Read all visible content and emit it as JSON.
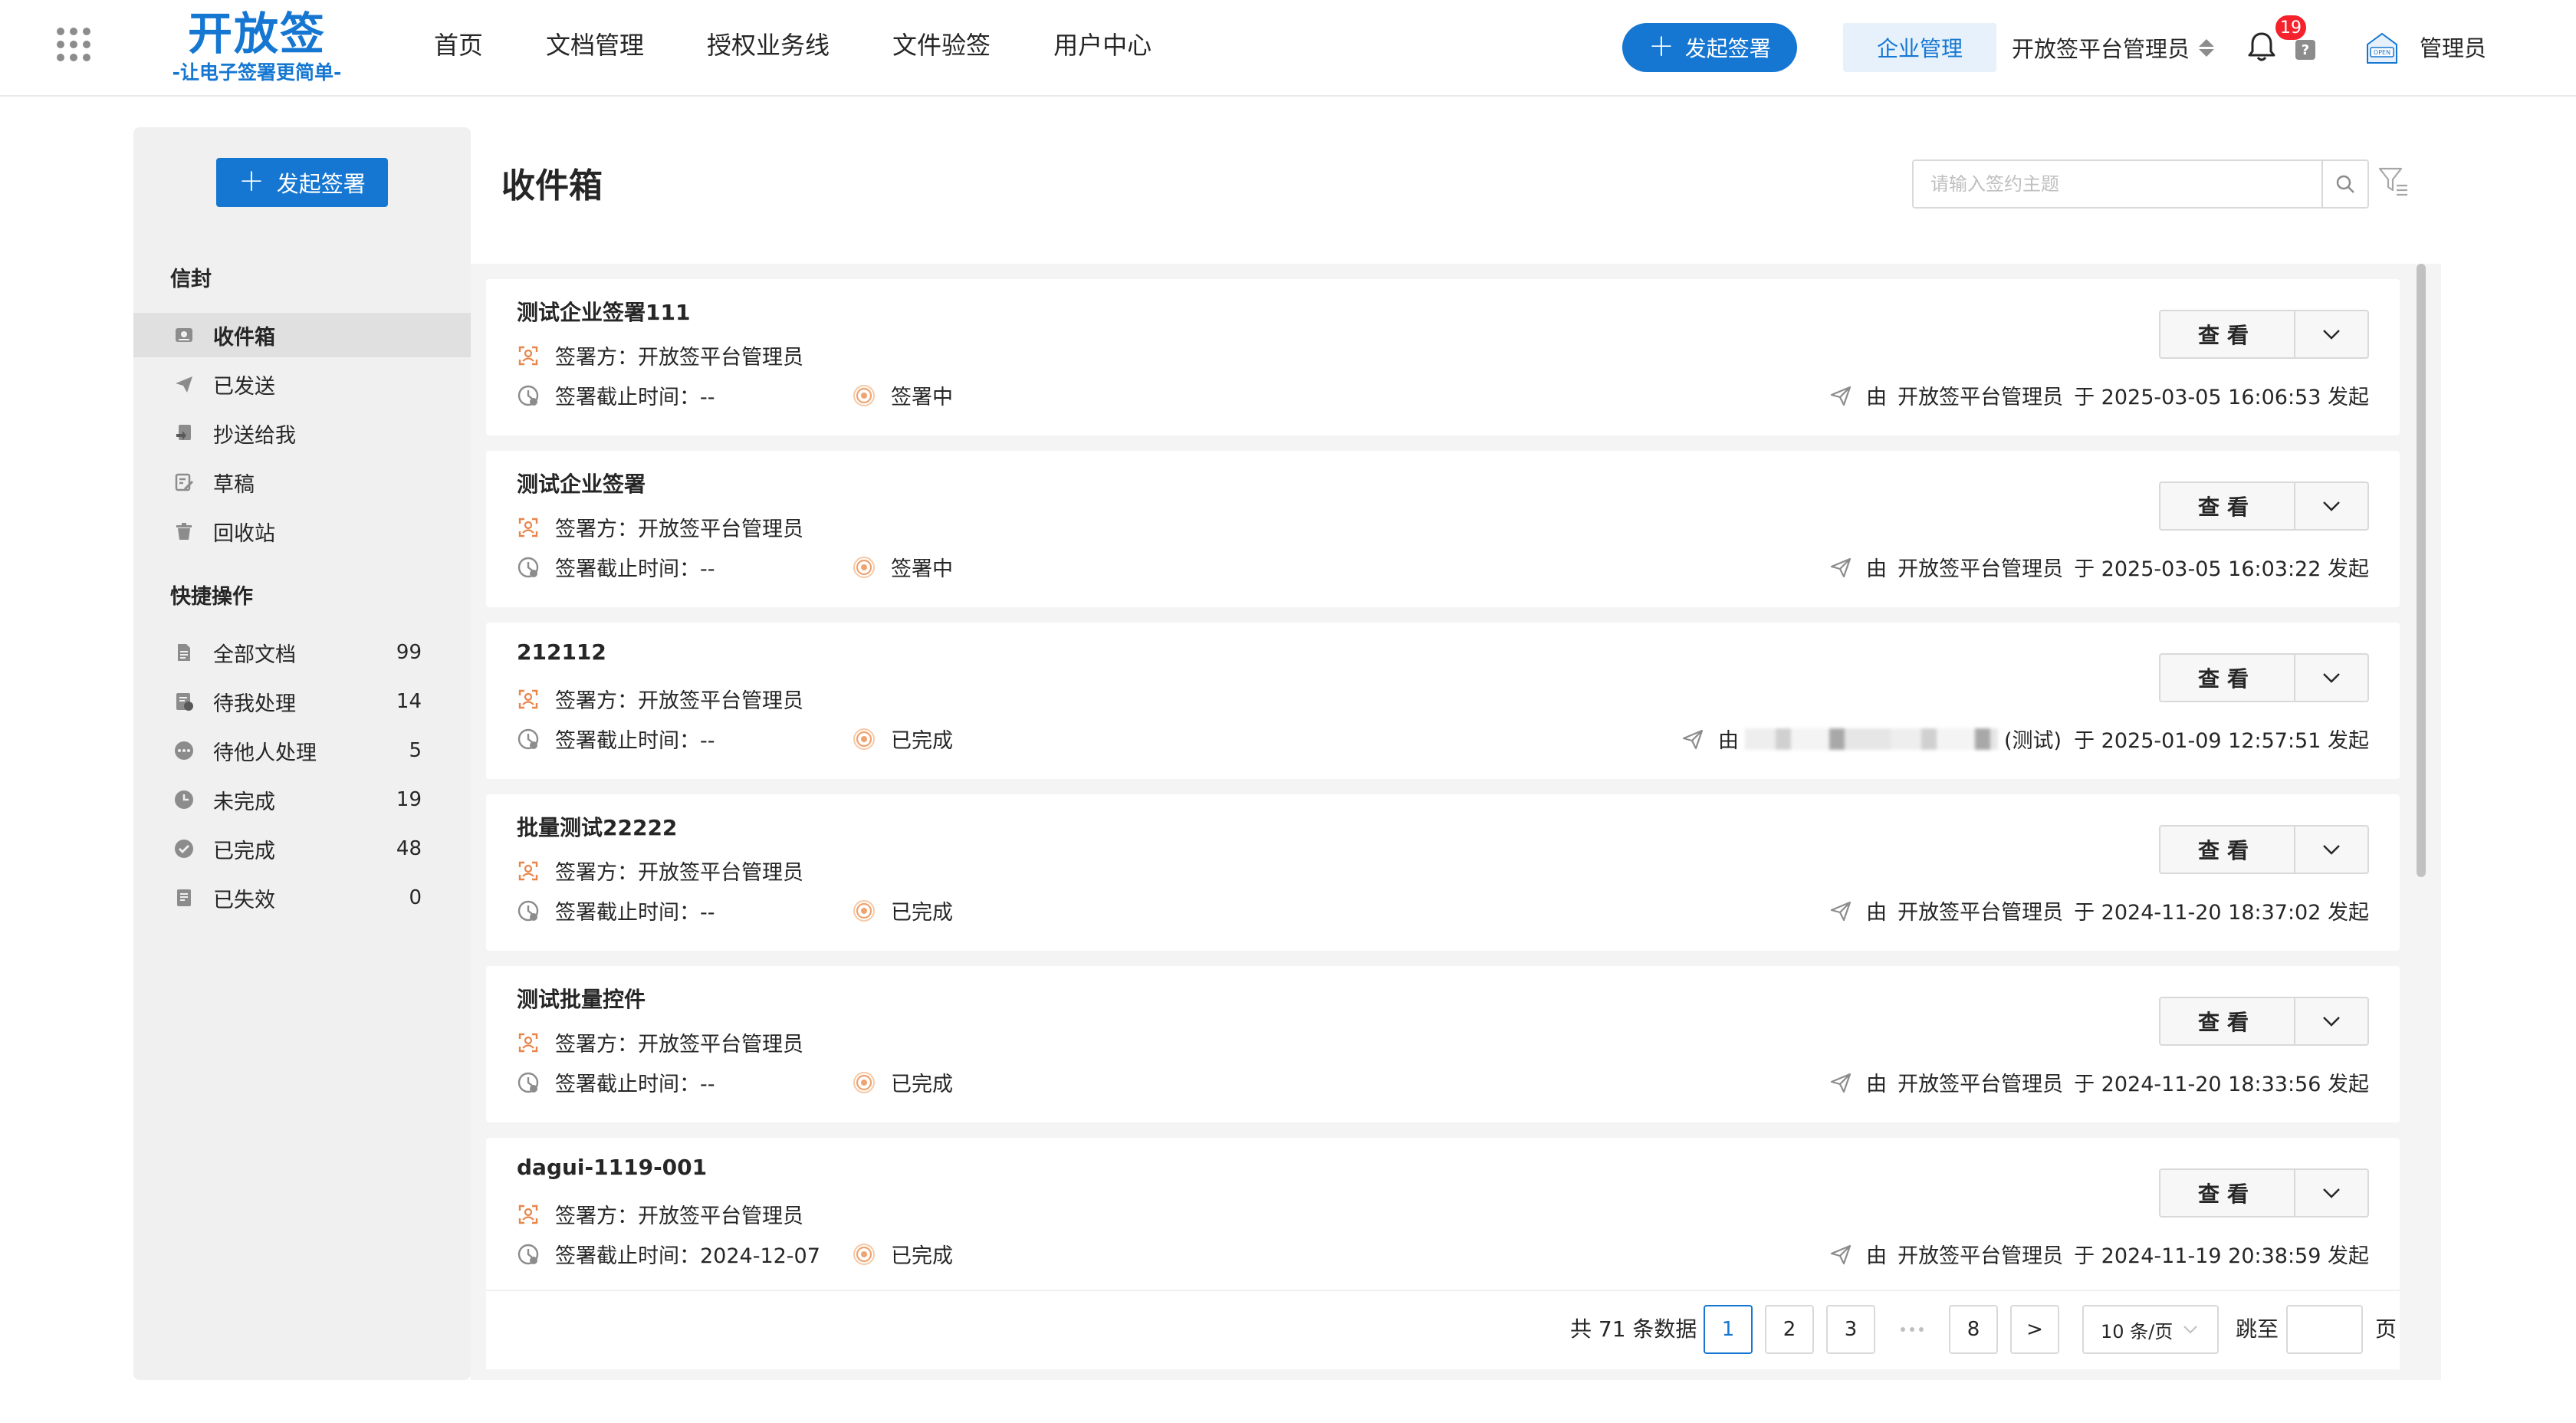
{
  "header": {
    "logo_title": "开放签",
    "logo_subtitle": "-让电子签署更简单-",
    "nav": [
      "首页",
      "文档管理",
      "授权业务线",
      "文件验签",
      "用户中心"
    ],
    "start_button": "发起签署",
    "org_manage": "企业管理",
    "org_name": "开放签平台管理员",
    "notification_count": "19",
    "help_mark": "?",
    "avatar_text": "OPEN",
    "user_name": "管理员"
  },
  "sidebar": {
    "start_button": "发起签署",
    "envelope_section": "信封",
    "envelope_items": [
      {
        "label": "收件箱",
        "icon": "inbox-icon",
        "active": true
      },
      {
        "label": "已发送",
        "icon": "send-icon"
      },
      {
        "label": "抄送给我",
        "icon": "cc-icon"
      },
      {
        "label": "草稿",
        "icon": "draft-icon"
      },
      {
        "label": "回收站",
        "icon": "trash-icon"
      }
    ],
    "quick_section": "快捷操作",
    "quick_items": [
      {
        "label": "全部文档",
        "count": "99",
        "icon": "document-icon"
      },
      {
        "label": "待我处理",
        "count": "14",
        "icon": "todo-icon"
      },
      {
        "label": "待他人处理",
        "count": "5",
        "icon": "more-icon"
      },
      {
        "label": "未完成",
        "count": "19",
        "icon": "clock-icon"
      },
      {
        "label": "已完成",
        "count": "48",
        "icon": "check-icon"
      },
      {
        "label": "已失效",
        "count": "0",
        "icon": "expired-icon"
      }
    ]
  },
  "main": {
    "title": "收件箱",
    "search_placeholder": "请输入签约主题",
    "view_label": "查看",
    "colors": {
      "brand": "#1677d2",
      "signer_icon": "#e8854a",
      "status_icon": "#f0a36e",
      "badge": "#f5222d"
    },
    "cards": [
      {
        "title": "测试企业签署111",
        "signer": "签署方：开放签平台管理员",
        "deadline": "签署截止时间：--",
        "status": "签署中",
        "sender_prefix": "由",
        "sender": "开放签平台管理员",
        "sent_at": "于 2025-03-05 16:06:53 发起",
        "sender_blurred": false
      },
      {
        "title": "测试企业签署",
        "signer": "签署方：开放签平台管理员",
        "deadline": "签署截止时间：--",
        "status": "签署中",
        "sender_prefix": "由",
        "sender": "开放签平台管理员",
        "sent_at": "于 2025-03-05 16:03:22 发起",
        "sender_blurred": false
      },
      {
        "title": "212112",
        "signer": "签署方：开放签平台管理员",
        "deadline": "签署截止时间：--",
        "status": "已完成",
        "sender_prefix": "由",
        "sender": "(测试)",
        "sent_at": "于 2025-01-09 12:57:51 发起",
        "sender_blurred": true
      },
      {
        "title": "批量测试22222",
        "signer": "签署方：开放签平台管理员",
        "deadline": "签署截止时间：--",
        "status": "已完成",
        "sender_prefix": "由",
        "sender": "开放签平台管理员",
        "sent_at": "于 2024-11-20 18:37:02 发起",
        "sender_blurred": false
      },
      {
        "title": "测试批量控件",
        "signer": "签署方：开放签平台管理员",
        "deadline": "签署截止时间：--",
        "status": "已完成",
        "sender_prefix": "由",
        "sender": "开放签平台管理员",
        "sent_at": "于 2024-11-20 18:33:56 发起",
        "sender_blurred": false
      },
      {
        "title": "dagui-1119-001",
        "signer": "签署方：开放签平台管理员",
        "deadline": "签署截止时间：2024-12-07",
        "status": "已完成",
        "sender_prefix": "由",
        "sender": "开放签平台管理员",
        "sent_at": "于 2024-11-19 20:38:59 发起",
        "sender_blurred": false
      }
    ]
  },
  "pagination": {
    "total_text": "共 71 条数据",
    "pages": [
      "1",
      "2",
      "3",
      "8"
    ],
    "current_page": "1",
    "prev": "<",
    "next": ">",
    "page_size": "10 条/页",
    "jump_label": "跳至",
    "jump_suffix": "页"
  }
}
